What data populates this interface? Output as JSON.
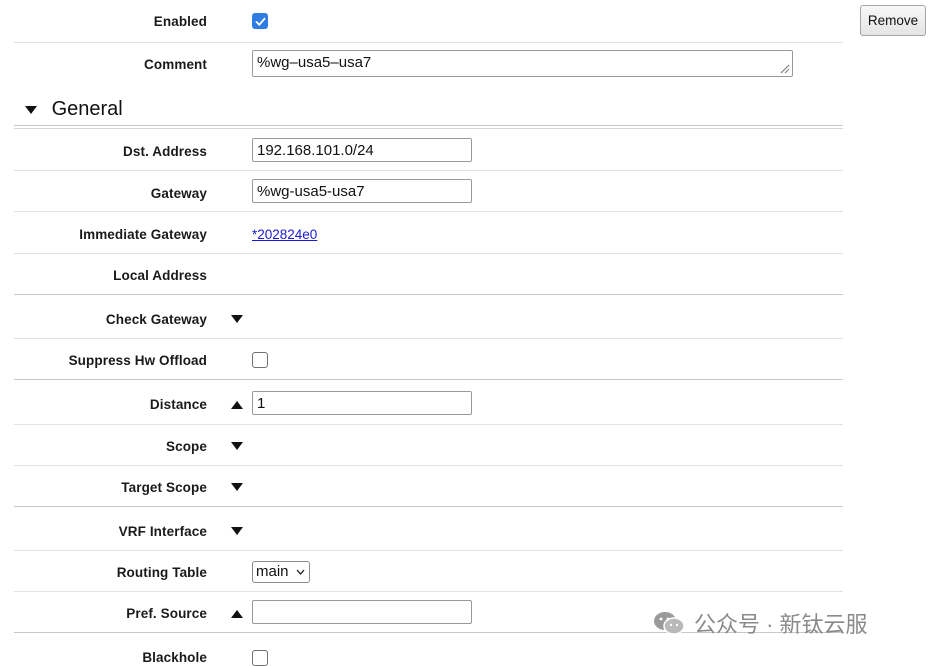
{
  "toolbar": {
    "remove_label": "Remove"
  },
  "fields": {
    "enabled": {
      "label": "Enabled",
      "checked": true
    },
    "comment": {
      "label": "Comment",
      "value": "%wg–usa5–usa7"
    },
    "dst_address": {
      "label": "Dst. Address",
      "value": "192.168.101.0/24"
    },
    "gateway": {
      "label": "Gateway",
      "value": "%wg-usa5-usa7"
    },
    "immediate_gateway": {
      "label": "Immediate Gateway",
      "value": "*202824e0"
    },
    "local_address": {
      "label": "Local Address"
    },
    "check_gateway": {
      "label": "Check Gateway"
    },
    "suppress_hw_offload": {
      "label": "Suppress Hw Offload",
      "checked": false
    },
    "distance": {
      "label": "Distance",
      "value": "1"
    },
    "scope": {
      "label": "Scope"
    },
    "target_scope": {
      "label": "Target Scope"
    },
    "vrf_interface": {
      "label": "VRF Interface"
    },
    "routing_table": {
      "label": "Routing Table",
      "value": "main"
    },
    "pref_source": {
      "label": "Pref. Source",
      "value": ""
    },
    "blackhole": {
      "label": "Blackhole",
      "checked": false
    }
  },
  "section": {
    "general_title": "General"
  },
  "watermark": {
    "text": "公众号 · 新钛云服"
  },
  "colors": {
    "checkbox_checked": "#2f7de1",
    "link": "#1a1ad6"
  },
  "icons": {
    "section_caret": "caret-down-icon",
    "expand": "triangle-down-icon",
    "collapse": "triangle-up-icon",
    "select": "chevron-down-icon",
    "watermark": "wechat-icon"
  }
}
